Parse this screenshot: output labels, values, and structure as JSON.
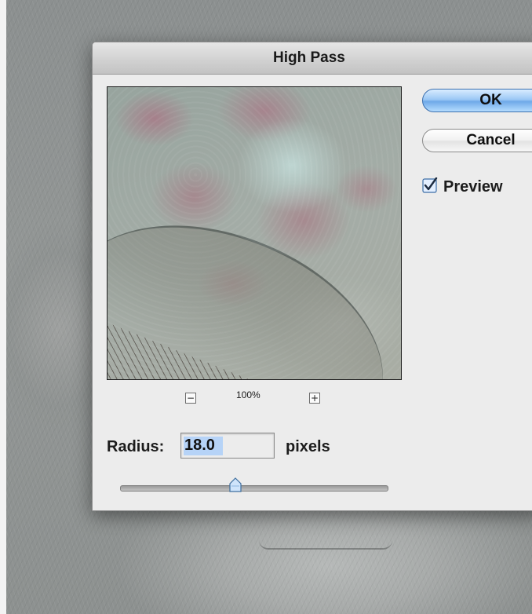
{
  "dialog": {
    "title": "High Pass"
  },
  "buttons": {
    "ok_label": "OK",
    "cancel_label": "Cancel"
  },
  "preview_option": {
    "label": "Preview",
    "checked": true
  },
  "zoom": {
    "out_symbol": "−",
    "in_symbol": "+",
    "level": "100%"
  },
  "radius": {
    "label": "Radius:",
    "value": "18.0",
    "unit": "pixels"
  },
  "slider": {
    "position_fraction": 0.43
  },
  "colors": {
    "ok_button_accent": "#6fa9e8",
    "checkbox_accent": "#4f8fdc",
    "dialog_background": "#ececec"
  },
  "icons": {
    "zoom_out": "minus-icon",
    "zoom_in": "plus-icon",
    "checkbox": "checkmark-icon",
    "slider_thumb": "slider-thumb-icon"
  }
}
